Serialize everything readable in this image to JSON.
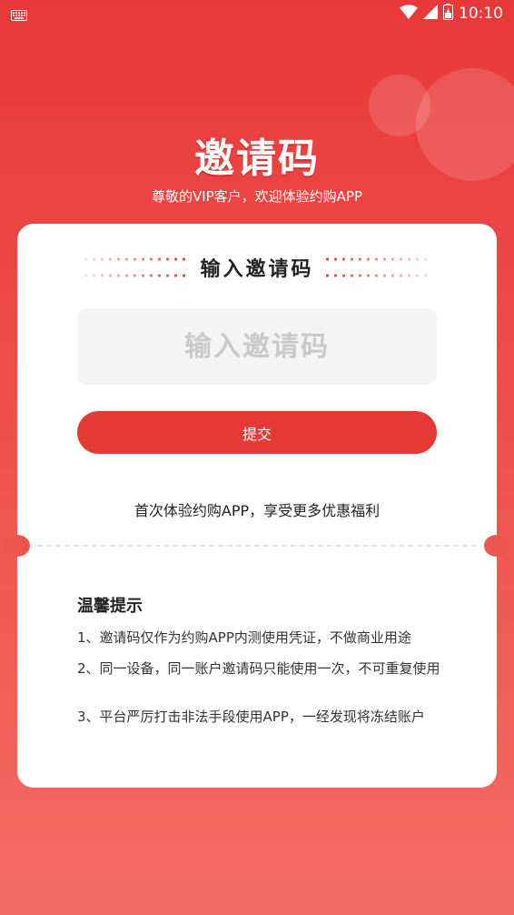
{
  "status_bar": {
    "keyboard_icon": "keyboard-icon",
    "time": "10:10"
  },
  "header": {
    "title": "邀请码",
    "subtitle": "尊敬的VIP客户，欢迎体验约购APP"
  },
  "invite": {
    "section_title": "输入邀请码",
    "input_placeholder": "输入邀请码",
    "input_value": "",
    "submit_label": "提交",
    "promo_text": "首次体验约购APP，享受更多优惠福利"
  },
  "tips": {
    "title": "温馨提示",
    "items": [
      "1、邀请码仅作为约购APP内测使用凭证，不做商业用途",
      "2、同一设备，同一账户邀请码只能使用一次，不可重复使用",
      "3、平台严厉打击非法手段使用APP，一经发现将冻结账户"
    ]
  },
  "colors": {
    "accent": "#e53935",
    "input_bg": "#f4f4f4",
    "placeholder": "#c9c9c9"
  }
}
